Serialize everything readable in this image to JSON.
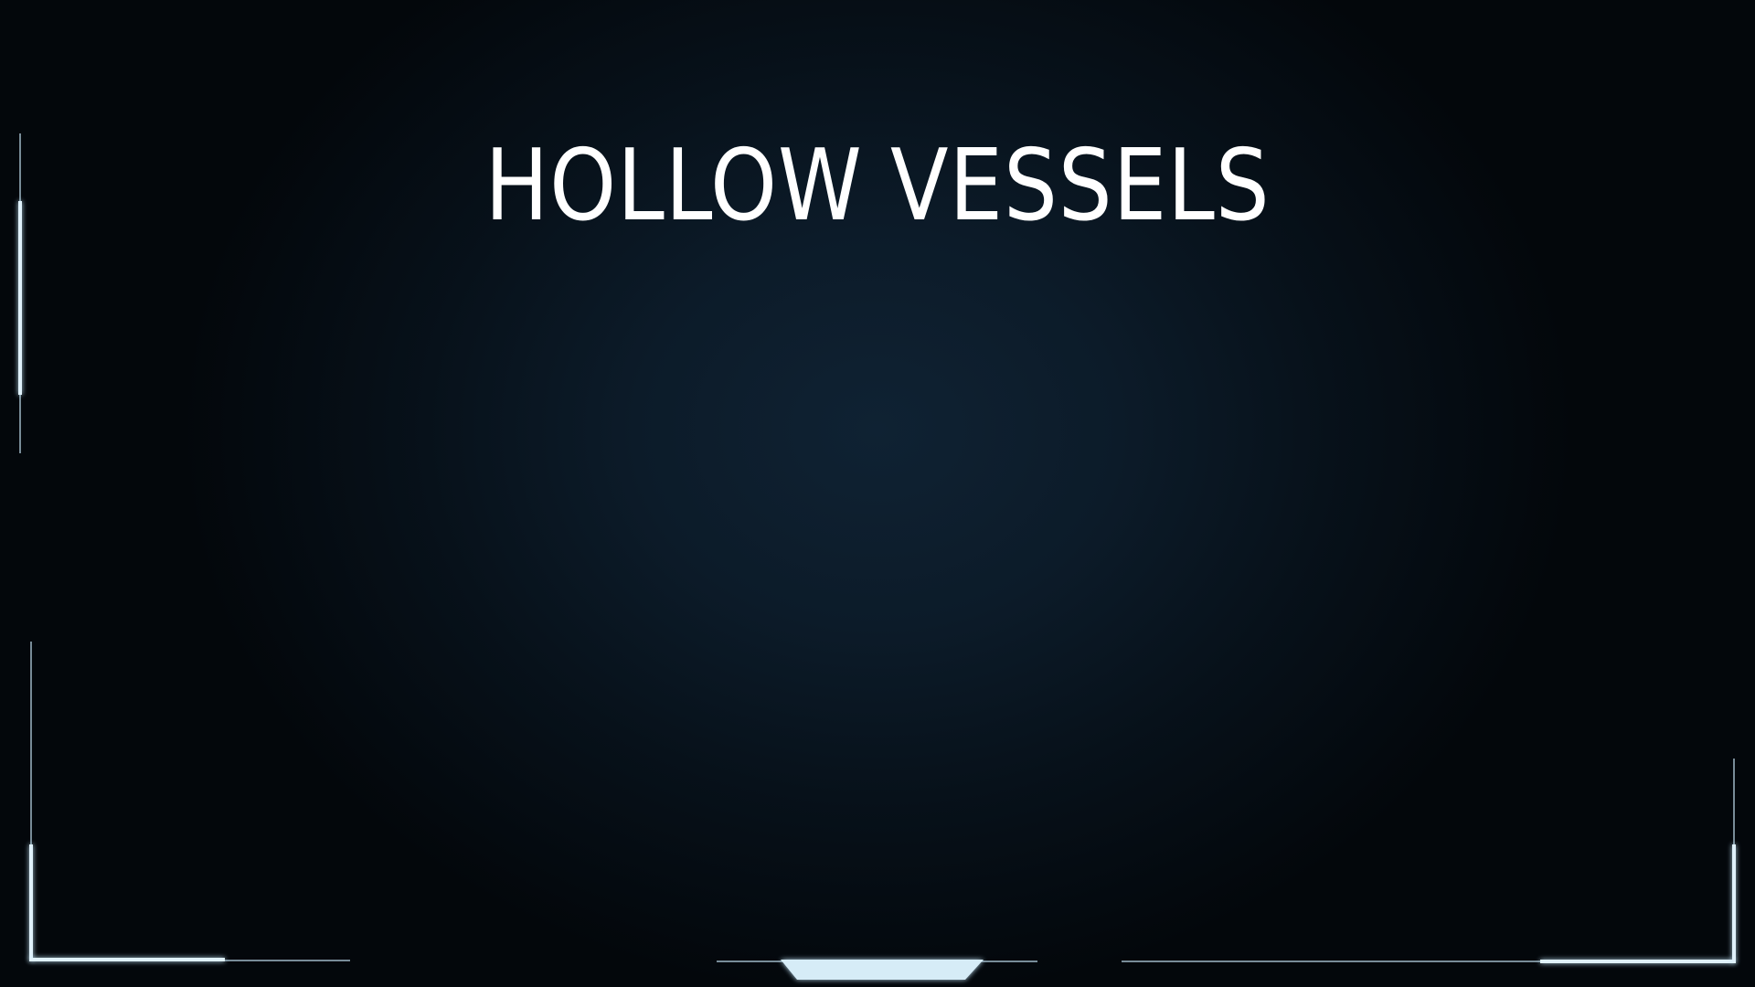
{
  "title": "HOLLOW VESSELS",
  "theme": {
    "accent": "#dff1fb",
    "accent_dim": "#9fb9c8",
    "background": "#0c1b29"
  }
}
